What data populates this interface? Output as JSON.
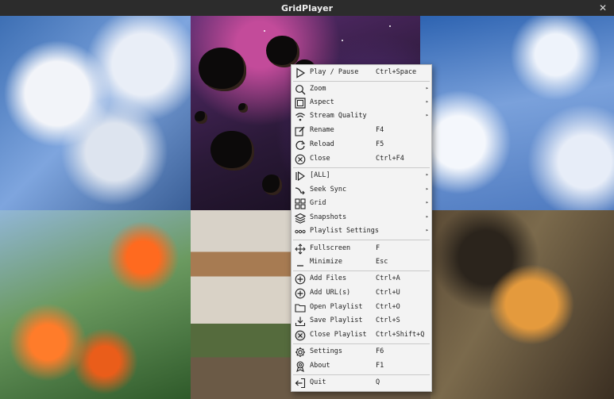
{
  "window": {
    "title": "GridPlayer"
  },
  "menu": {
    "items": [
      {
        "label": "Play / Pause",
        "shortcut": "Ctrl+Space",
        "icon": "play-icon"
      },
      {
        "label": "Zoom",
        "shortcut": "",
        "icon": "zoom-icon"
      },
      {
        "label": "Aspect",
        "shortcut": "",
        "icon": "aspect-icon"
      },
      {
        "label": "Stream Quality",
        "shortcut": "",
        "icon": "wifi-icon"
      },
      {
        "label": "Rename",
        "shortcut": "F4",
        "icon": "rename-icon"
      },
      {
        "label": "Reload",
        "shortcut": "F5",
        "icon": "reload-icon"
      },
      {
        "label": "Close",
        "shortcut": "Ctrl+F4",
        "icon": "close-icon"
      },
      {
        "label": "[ALL]",
        "shortcut": "",
        "icon": "all-icon"
      },
      {
        "label": "Seek Sync",
        "shortcut": "",
        "icon": "seek-sync-icon"
      },
      {
        "label": "Grid",
        "shortcut": "",
        "icon": "grid-icon"
      },
      {
        "label": "Snapshots",
        "shortcut": "",
        "icon": "layers-icon"
      },
      {
        "label": "Playlist Settings",
        "shortcut": "",
        "icon": "dots-icon"
      },
      {
        "label": "Fullscreen",
        "shortcut": "F",
        "icon": "fullscreen-icon"
      },
      {
        "label": "Minimize",
        "shortcut": "Esc",
        "icon": "minimize-icon"
      },
      {
        "label": "Add Files",
        "shortcut": "Ctrl+A",
        "icon": "add-files-icon"
      },
      {
        "label": "Add URL(s)",
        "shortcut": "Ctrl+U",
        "icon": "add-url-icon"
      },
      {
        "label": "Open Playlist",
        "shortcut": "Ctrl+O",
        "icon": "folder-icon"
      },
      {
        "label": "Save Playlist",
        "shortcut": "Ctrl+S",
        "icon": "save-icon"
      },
      {
        "label": "Close Playlist",
        "shortcut": "Ctrl+Shift+Q",
        "icon": "close-playlist-icon"
      },
      {
        "label": "Settings",
        "shortcut": "F6",
        "icon": "gear-icon"
      },
      {
        "label": "About",
        "shortcut": "F1",
        "icon": "about-icon"
      },
      {
        "label": "Quit",
        "shortcut": "Q",
        "icon": "quit-icon"
      }
    ]
  }
}
